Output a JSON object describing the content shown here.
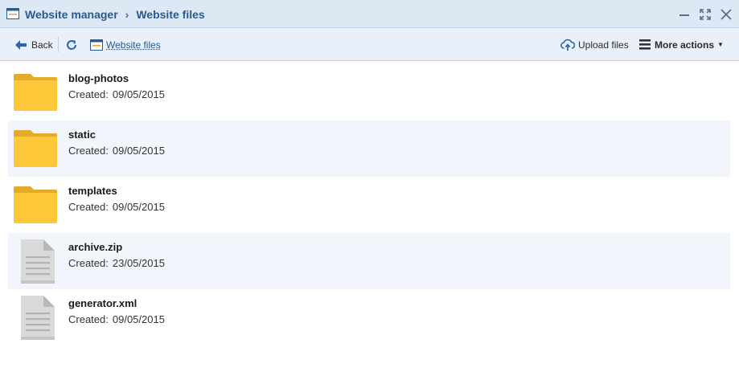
{
  "breadcrumb": [
    "Website manager",
    "Website files"
  ],
  "breadcrumb_separator": "›",
  "toolbar": {
    "back_label": "Back",
    "site_label": "Website files",
    "upload_label": "Upload files",
    "more_label": "More actions"
  },
  "created_label": "Created:",
  "files": [
    {
      "name": "blog-photos",
      "date": "09/05/2015",
      "type": "folder"
    },
    {
      "name": "static",
      "date": "09/05/2015",
      "type": "folder"
    },
    {
      "name": "templates",
      "date": "09/05/2015",
      "type": "folder"
    },
    {
      "name": "archive.zip",
      "date": "23/05/2015",
      "type": "file"
    },
    {
      "name": "generator.xml",
      "date": "09/05/2015",
      "type": "file"
    }
  ],
  "colors": {
    "accent": "#2a5a8c",
    "titlebar": "#dde8f5",
    "toolbar": "#e9f0f9",
    "folder": "#fcc83a",
    "row_alt": "#f2f6fc"
  }
}
